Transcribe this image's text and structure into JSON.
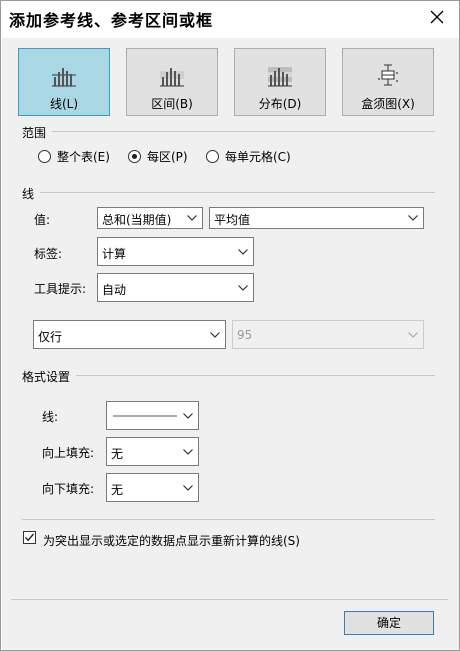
{
  "window": {
    "title": "添加参考线、参考区间或框"
  },
  "tabs": [
    {
      "label": "线(L)",
      "selected": true,
      "icon": "line-chart-icon"
    },
    {
      "label": "区间(B)",
      "selected": false,
      "icon": "band-chart-icon"
    },
    {
      "label": "分布(D)",
      "selected": false,
      "icon": "distribution-chart-icon"
    },
    {
      "label": "盒须图(X)",
      "selected": false,
      "icon": "box-plot-icon"
    }
  ],
  "scope": {
    "heading": "范围",
    "options": [
      "整个表(E)",
      "每区(P)",
      "每单元格(C)"
    ],
    "selected": "每区(P)"
  },
  "line": {
    "heading": "线",
    "value_label": "值:",
    "value_field": "总和(当期值)",
    "value_agg": "平均值",
    "label_label": "标签:",
    "label_value": "计算",
    "tooltip_label": "工具提示:",
    "tooltip_value": "自动",
    "line_only": "仅行",
    "confidence": "95"
  },
  "format": {
    "heading": "格式设置",
    "line_label": "线:",
    "fill_above_label": "向上填充:",
    "fill_above_value": "无",
    "fill_below_label": "向下填充:",
    "fill_below_value": "无"
  },
  "recalc": {
    "label": "为突出显示或选定的数据点显示重新计算的线(S)",
    "checked": true
  },
  "footer": {
    "ok_label": "确定"
  },
  "colors": {
    "selected_tile": "#a9d8e4",
    "selected_border": "#3d9bc9",
    "dialog_bg": "#f0f0f0"
  }
}
